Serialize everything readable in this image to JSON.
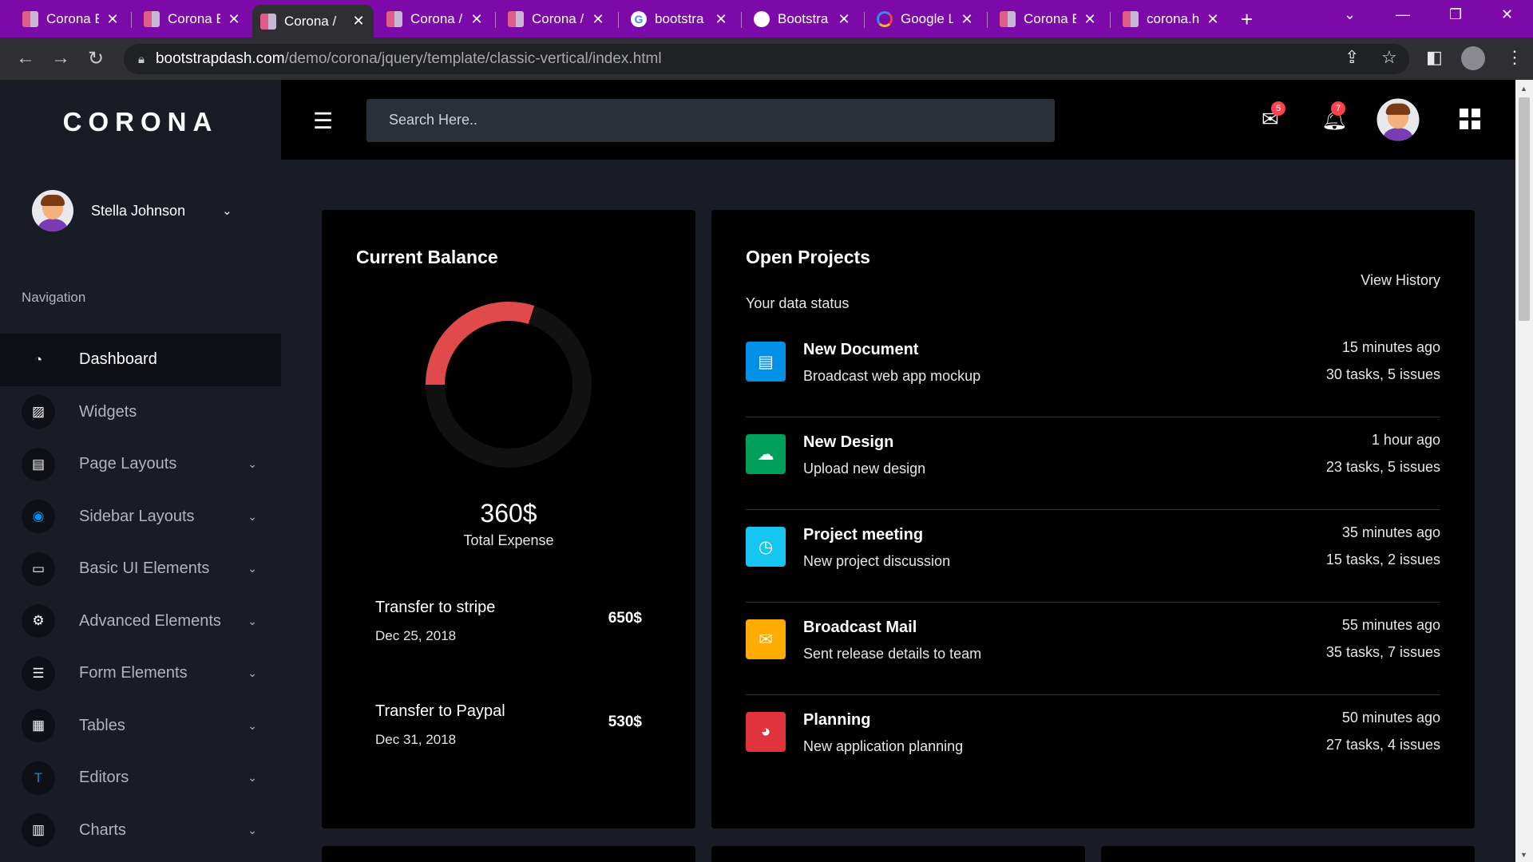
{
  "browser": {
    "tabs": [
      {
        "title": "Corona E",
        "favicon": "corona-icon"
      },
      {
        "title": "Corona E",
        "favicon": "corona-icon"
      },
      {
        "title": "Corona /",
        "favicon": "corona-icon",
        "active": true
      },
      {
        "title": "Corona /",
        "favicon": "corona-icon"
      },
      {
        "title": "Corona /",
        "favicon": "corona-icon"
      },
      {
        "title": "bootstra",
        "favicon": "google-icon"
      },
      {
        "title": "Bootstra",
        "favicon": "github-icon"
      },
      {
        "title": "Google L",
        "favicon": "google-lens-icon"
      },
      {
        "title": "Corona E",
        "favicon": "corona-icon"
      },
      {
        "title": "corona.h",
        "favicon": "corona-icon"
      }
    ],
    "url_host": "bootstrapdash.com",
    "url_path": "/demo/corona/jquery/template/classic-vertical/index.html"
  },
  "sidebar": {
    "brand": "CORONA",
    "user_name": "Stella Johnson",
    "nav_category": "Navigation",
    "items": [
      {
        "label": "Dashboard",
        "icon": "speedometer-icon",
        "color": "#ffffff",
        "active": true,
        "has_submenu": false
      },
      {
        "label": "Widgets",
        "icon": "widgets-icon",
        "color": "#ffffff",
        "has_submenu": false
      },
      {
        "label": "Page Layouts",
        "icon": "page-layout-icon",
        "color": "#ffffff",
        "has_submenu": true
      },
      {
        "label": "Sidebar Layouts",
        "icon": "target-icon",
        "color": "#0090e7",
        "has_submenu": true
      },
      {
        "label": "Basic UI Elements",
        "icon": "laptop-icon",
        "color": "#ffffff",
        "has_submenu": true
      },
      {
        "label": "Advanced Elements",
        "icon": "gear-icon",
        "color": "#ffffff",
        "has_submenu": true
      },
      {
        "label": "Form Elements",
        "icon": "form-icon",
        "color": "#ffffff",
        "has_submenu": true
      },
      {
        "label": "Tables",
        "icon": "table-icon",
        "color": "#ffffff",
        "has_submenu": true
      },
      {
        "label": "Editors",
        "icon": "text-editor-icon",
        "color": "#0090e7",
        "has_submenu": true
      },
      {
        "label": "Charts",
        "icon": "chart-icon",
        "color": "#ffffff",
        "has_submenu": true
      }
    ]
  },
  "topbar": {
    "search_placeholder": "Search Here..",
    "mail_count": "5",
    "notification_count": "7"
  },
  "balance": {
    "title": "Current Balance",
    "value": "360$",
    "label": "Total Expense",
    "donut_filled_fraction": 0.3,
    "donut_color": "#e04a4a",
    "transactions": [
      {
        "title": "Transfer to stripe",
        "date": "Dec 25, 2018",
        "amount": "650$"
      },
      {
        "title": "Transfer to Paypal",
        "date": "Dec 31, 2018",
        "amount": "530$"
      }
    ]
  },
  "projects": {
    "title": "Open Projects",
    "subtitle": "Your data status",
    "view_history": "View History",
    "items": [
      {
        "title": "New Document",
        "desc": "Broadcast web app mockup",
        "time": "15 minutes ago",
        "tasks": "30 tasks, 5 issues",
        "color": "#0090e7",
        "icon": "document-icon"
      },
      {
        "title": "New Design",
        "desc": "Upload new design",
        "time": "1 hour ago",
        "tasks": "23 tasks, 5 issues",
        "color": "#00a05a",
        "icon": "cloud-upload-icon"
      },
      {
        "title": "Project meeting",
        "desc": "New project discussion",
        "time": "35 minutes ago",
        "tasks": "15 tasks, 2 issues",
        "color": "#17c6f0",
        "icon": "clock-icon"
      },
      {
        "title": "Broadcast Mail",
        "desc": "Sent release details to team",
        "time": "55 minutes ago",
        "tasks": "35 tasks, 7 issues",
        "color": "#ffab00",
        "icon": "mail-icon"
      },
      {
        "title": "Planning",
        "desc": "New application planning",
        "time": "50 minutes ago",
        "tasks": "27 tasks, 4 issues",
        "color": "#e0333b",
        "icon": "pie-chart-icon"
      }
    ]
  }
}
